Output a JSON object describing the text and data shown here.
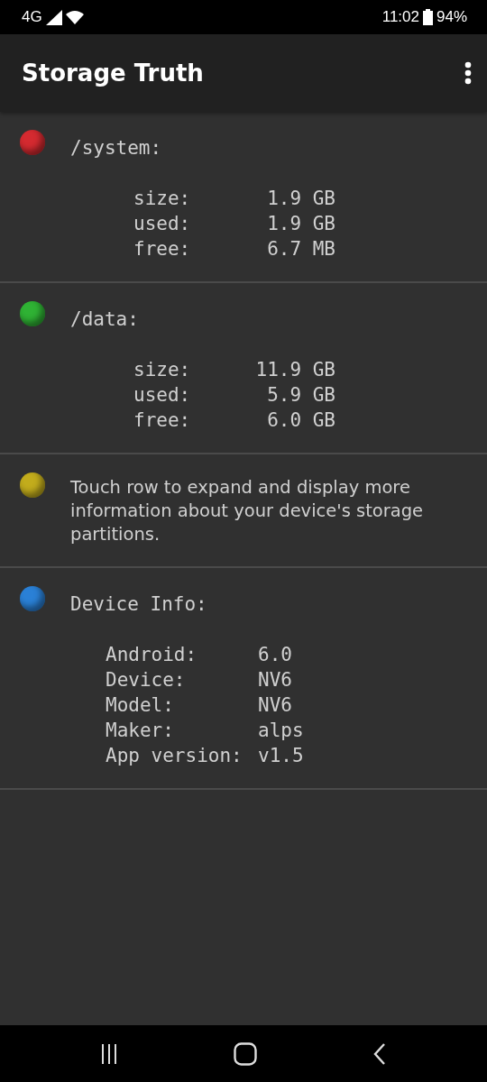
{
  "status_bar": {
    "network": "4G",
    "time": "11:02",
    "battery": "94%"
  },
  "app_bar": {
    "title": "Storage Truth"
  },
  "rows": [
    {
      "kind": "partition",
      "color": "#d42a30",
      "title": "/system:",
      "lines": [
        {
          "label": "size:",
          "value": "1.9 GB"
        },
        {
          "label": "used:",
          "value": "1.9 GB"
        },
        {
          "label": "free:",
          "value": "6.7 MB"
        }
      ]
    },
    {
      "kind": "partition",
      "color": "#2fb234",
      "title": "/data:",
      "lines": [
        {
          "label": "size:",
          "value": "11.9 GB"
        },
        {
          "label": "used:",
          "value": "5.9 GB"
        },
        {
          "label": "free:",
          "value": "6.0 GB"
        }
      ]
    },
    {
      "kind": "note",
      "color": "#c2ac1c",
      "text": "Touch row to expand and display more information about your device's storage partitions."
    },
    {
      "kind": "info",
      "color": "#2a80d6",
      "title": "Device Info:",
      "lines": [
        {
          "label": "Android:",
          "value": "6.0"
        },
        {
          "label": "Device:",
          "value": "NV6"
        },
        {
          "label": "Model:",
          "value": "NV6"
        },
        {
          "label": "Maker:",
          "value": "alps"
        },
        {
          "label": "App version:",
          "value": "v1.5"
        }
      ]
    }
  ]
}
